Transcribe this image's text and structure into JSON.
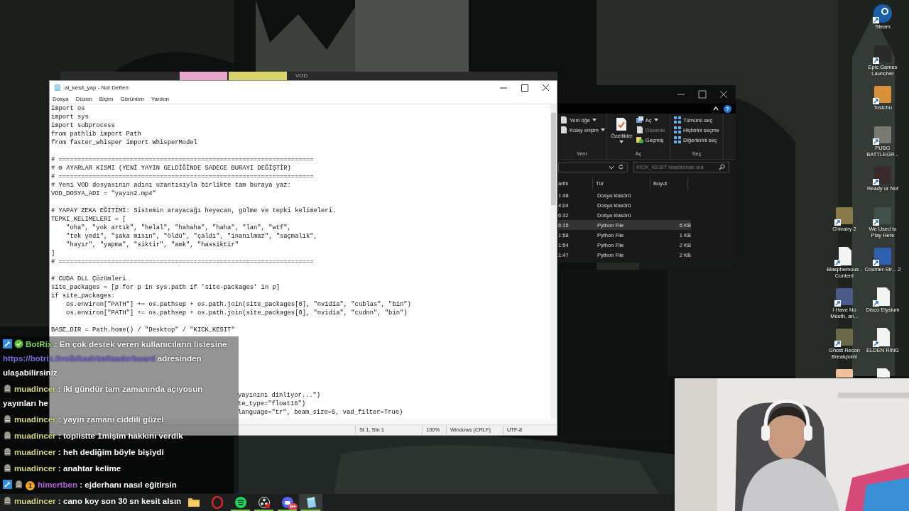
{
  "behind_window": {
    "label": "VOD",
    "tabs": [
      {
        "color": "#e8a6cc"
      },
      {
        "color": "#d9d46a"
      }
    ]
  },
  "notepad": {
    "title": "ai_kesit_yap - Not Defteri",
    "menu": [
      "Dosya",
      "Düzen",
      "Biçim",
      "Görünüm",
      "Yardım"
    ],
    "content": "import os\nimport sys\nimport subprocess\nfrom pathlib import Path\nfrom faster_whisper import WhisperModel\n\n# ====================================================================\n# ⚙ AYARLAR KISMI (YENİ YAYIN GELDİĞİNDE SADECE BURAYI DEĞİŞTİR)\n# ====================================================================\n# Yeni VOD dosyasının adını uzantısıyla birlikte tam buraya yaz:\nVOD_DOSYA_ADI = \"yayın2.mp4\"\n\n# YAPAY ZEKA EĞİTİMİ: Sistemin arayacağı heyecan, gülme ve tepki kelimeleri.\nTEPKI_KELIMELERI = [\n    \"oha\", \"yok artık\", \"helal\", \"hahaha\", \"haha\", \"lan\", \"wtf\",\n    \"tek yedi\", \"şaka mısın\", \"öldü\", \"çaldı\", \"inanılmaz\", \"saçmalık\",\n    \"hayır\", \"yapma\", \"siktir\", \"amk\", \"hassiktir\"\n]\n# ====================================================================\n\n# CUDA DLL Çözümleri\nsite_packages = [p for p in sys.path if 'site-packages' in p]\nif site_packages:\n    os.environ[\"PATH\"] += os.pathsep + os.path.join(site_packages[0], \"nvidia\", \"cublas\", \"bin\")\n    os.environ[\"PATH\"] += os.pathsep + os.path.join(site_packages[0], \"nvidia\", \"cudnn\", \"bin\")\n\nBASE_DIR = Path.home() / \"Desktop\" / \"KICK_KESIT\"",
    "content_tail": "yayınını dinliyor...\")\nte_type=\"float16\")\nlanguage=\"tr\", beam_size=5, vad_filter=True)",
    "status": [
      "St 1, Stn 1",
      "100%",
      "Windows (CRLF)",
      "UTF-8"
    ]
  },
  "explorer": {
    "help": "?",
    "ribbon_groups": [
      {
        "label": "Yeni",
        "items": [
          {
            "label": "Yeni öğe",
            "kind": "page",
            "dropdown": true,
            "disabled": false
          },
          {
            "label": "Kolay erişim",
            "kind": "page",
            "dropdown": true,
            "disabled": false
          }
        ]
      },
      {
        "label": "Aç",
        "items": [
          {
            "label": "Özellikler",
            "kind": "large",
            "dropdown": true,
            "disabled": false
          },
          {
            "label": "Aç",
            "kind": "open",
            "dropdown": true,
            "disabled": false
          },
          {
            "label": "Düzenle",
            "kind": "page",
            "dropdown": false,
            "disabled": true
          },
          {
            "label": "Geçmiş",
            "kind": "history",
            "dropdown": false,
            "disabled": false
          }
        ]
      },
      {
        "label": "Seç",
        "items": [
          {
            "label": "Tümünü seç",
            "kind": "grid",
            "dropdown": false,
            "disabled": false
          },
          {
            "label": "Hiçbirini seçme",
            "kind": "grid",
            "dropdown": false,
            "disabled": false
          },
          {
            "label": "Diğerlerini seç",
            "kind": "grid",
            "dropdown": false,
            "disabled": false
          }
        ]
      }
    ],
    "search": {
      "placeholder": "KICK_KESIT klasöründe ara"
    },
    "columns": [
      "arihi",
      "Tür",
      "Boyut"
    ],
    "rows": [
      {
        "date": "1:48",
        "type": "Dosya klasörü",
        "selected": false
      },
      {
        "date": "4:04",
        "type": "Dosya klasörü",
        "selected": false
      },
      {
        "date": "6:32",
        "type": "Dosya klasörü",
        "selected": false
      },
      {
        "date": "6:15",
        "type": "Python File",
        "size": "5 KB",
        "selected": true
      },
      {
        "date": "1:58",
        "type": "Python File",
        "size": "1 KB",
        "selected": false
      },
      {
        "date": "1:54",
        "type": "Python File",
        "size": "2 KB",
        "selected": false
      },
      {
        "date": "1:47",
        "type": "Python File",
        "size": "2 KB",
        "selected": false
      }
    ]
  },
  "desktop_icons": [
    [
      {
        "label": "Chivalry 2",
        "kind": "app",
        "color": "#8a7a4a"
      },
      {
        "label": "Blasphemous - Content",
        "kind": "file"
      },
      {
        "label": "I Have No Mouth, an...",
        "kind": "app",
        "color": "#4a5a8a"
      },
      {
        "label": "Ghost Recon Breakpoint",
        "kind": "app",
        "color": "#6a6a4a"
      },
      {
        "kind": "app",
        "color": "#f0c09a"
      }
    ],
    [
      {
        "label": "Steam",
        "kind": "round",
        "color": "#1b5fa8"
      },
      {
        "label": "Epic Games Launcher",
        "kind": "app",
        "color": "#2a2a2a"
      },
      {
        "label": "Tostchu",
        "kind": "app",
        "color": "#d9913a"
      },
      {
        "label": "PUBG BATTLEGR...",
        "kind": "app",
        "color": "#7a7a70"
      },
      {
        "label": "Ready or Not",
        "kind": "app",
        "color": "#3a2a2a"
      },
      {
        "label": "We Used to Play Here",
        "kind": "app",
        "color": "#40504a"
      },
      {
        "label": "Counter-Str... 2",
        "kind": "app",
        "color": "#2f5fb0"
      },
      {
        "label": "Disco Elysium",
        "kind": "file"
      },
      {
        "label": "ELDEN RING",
        "kind": "file"
      },
      {
        "kind": "file"
      }
    ]
  ],
  "chat": [
    {
      "user": "BotRix",
      "color": "#7ed957",
      "badges": [
        {
          "kind": "mod"
        },
        {
          "kind": "verified"
        }
      ],
      "text": ": En çok destek veren kullanıcıların listesine",
      "link": "https://botrix.live/k/kodrim/leaderboard",
      "text_after": "adresinden ulaşabilirsiniz"
    },
    {
      "user": "muadincer",
      "color": "#d6d67a",
      "badges": [
        {
          "kind": "avatar"
        }
      ],
      "text": ": iki gündür tam zamanında açıyosun yayınları he"
    },
    {
      "user": "muadincer",
      "color": "#d6d67a",
      "badges": [
        {
          "kind": "avatar"
        }
      ],
      "text": ": yayın zamanı ciddili güzel"
    },
    {
      "user": "muadincer",
      "color": "#d6d67a",
      "badges": [
        {
          "kind": "avatar"
        }
      ],
      "text": ": toplistte 1mişim hakkını verdik"
    },
    {
      "user": "muadincer",
      "color": "#d6d67a",
      "badges": [
        {
          "kind": "avatar"
        }
      ],
      "text": ": heh dediğim böyle bişiydi"
    },
    {
      "user": "muadincer",
      "color": "#d6d67a",
      "badges": [
        {
          "kind": "avatar"
        }
      ],
      "text": ": anahtar kelime"
    },
    {
      "user": "himertben",
      "color": "#b964e0",
      "badges": [
        {
          "kind": "mod"
        },
        {
          "kind": "avatar"
        },
        {
          "kind": "count",
          "label": "1"
        }
      ],
      "text": ": ejderhanı nasıl eğitirsin"
    },
    {
      "user": "muadincer",
      "color": "#d6d67a",
      "badges": [
        {
          "kind": "avatar"
        }
      ],
      "text": ": cano koy son 30 sn kesit alsın"
    }
  ],
  "taskbar": [
    {
      "kind": "folder",
      "active": false,
      "running": false
    },
    {
      "kind": "ring",
      "active": false,
      "running": false
    },
    {
      "kind": "music",
      "active": false,
      "running": true
    },
    {
      "kind": "record",
      "active": false,
      "running": true
    },
    {
      "kind": "chat",
      "active": false,
      "running": true,
      "badge": "9+"
    },
    {
      "kind": "notepad",
      "active": true,
      "running": true
    }
  ],
  "webcam": {
    "kind": "picture"
  }
}
